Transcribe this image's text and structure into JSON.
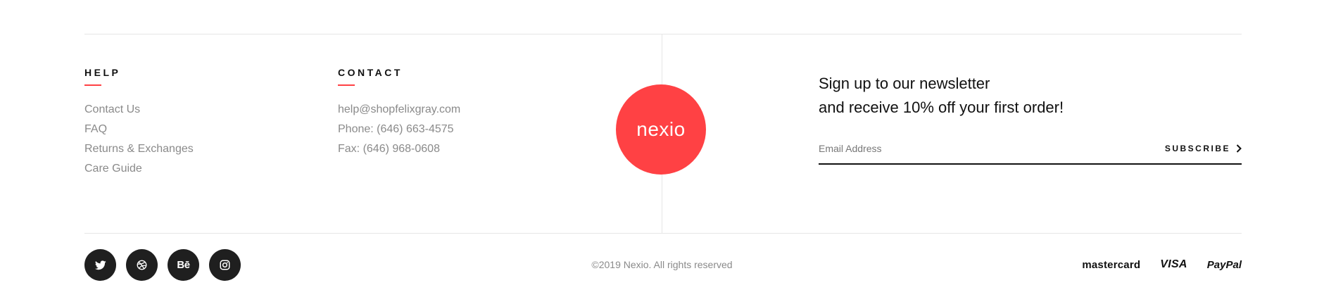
{
  "help": {
    "title": "HELP",
    "links": [
      "Contact Us",
      "FAQ",
      "Returns & Exchanges",
      "Care Guide"
    ]
  },
  "contact": {
    "title": "CONTACT",
    "email": "help@shopfelixgray.com",
    "phone": "Phone: (646) 663-4575",
    "fax": "Fax: (646) 968-0608"
  },
  "logo": {
    "text": "nexio",
    "color": "#ff4144"
  },
  "newsletter": {
    "line1": "Sign up to our newsletter",
    "line2": "and receive 10% off your first order!",
    "placeholder": "Email Address",
    "value": "",
    "subscribe_label": "SUBSCRIBE"
  },
  "social": {
    "icons": [
      "twitter-icon",
      "dribbble-icon",
      "behance-icon",
      "instagram-icon"
    ],
    "behance_text": "Bē"
  },
  "copyright": "©2019 Nexio. All rights reserved",
  "payments": {
    "mastercard": "mastercard",
    "visa": "VISA",
    "paypal": "PayPal"
  },
  "colors": {
    "accent": "#ff4144",
    "text": "#111111",
    "muted": "#8a8a8a",
    "divider": "#e6e6e6",
    "social_bg": "#1f1f1f"
  }
}
